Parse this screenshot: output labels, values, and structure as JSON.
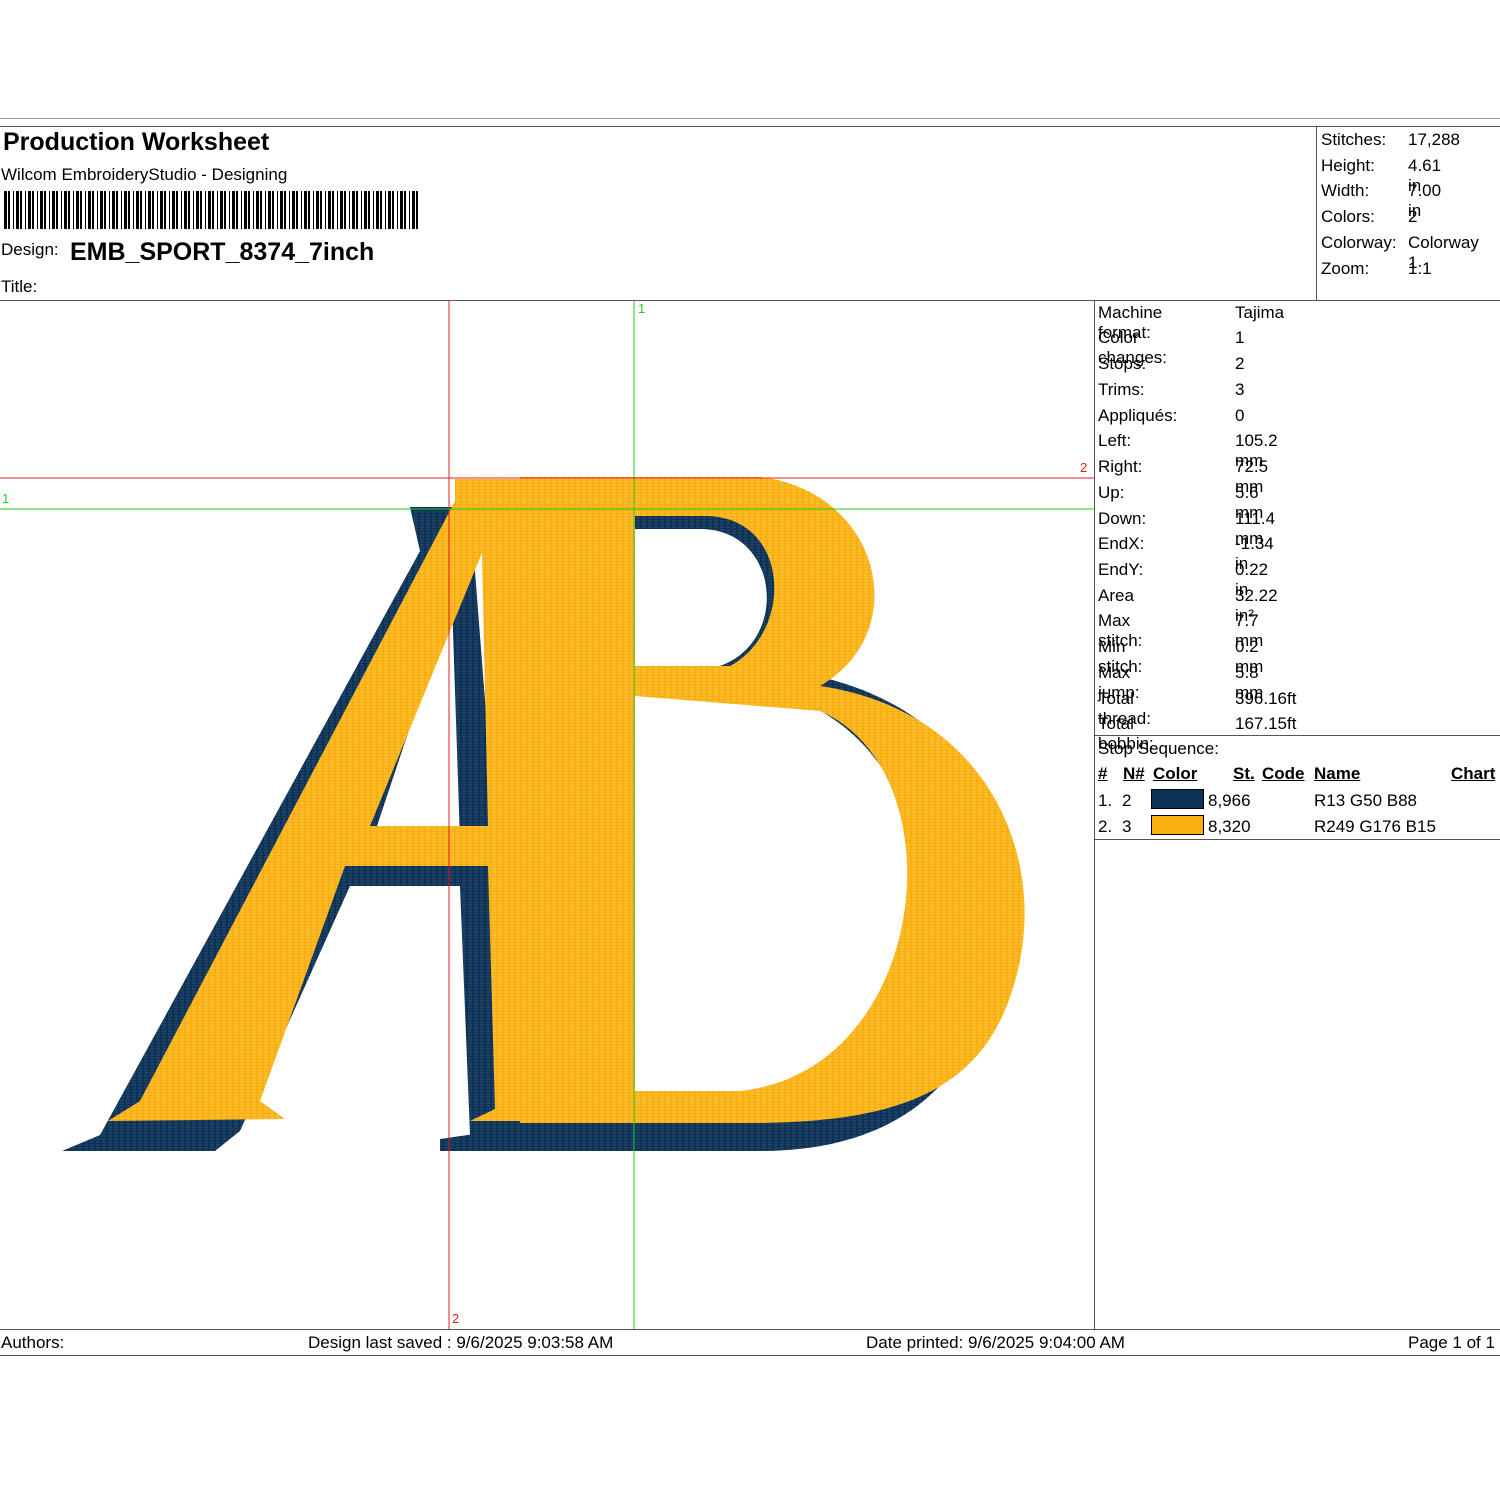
{
  "header": {
    "title": "Production Worksheet",
    "subtitle": "Wilcom EmbroideryStudio - Designing",
    "design_label": "Design:",
    "design_name": "EMB_SPORT_8374_7inch",
    "title_label": "Title:"
  },
  "summary": [
    {
      "label": "Stitches:",
      "value": "17,288"
    },
    {
      "label": "Height:",
      "value": "4.61 in"
    },
    {
      "label": "Width:",
      "value": "7.00 in"
    },
    {
      "label": "Colors:",
      "value": "2"
    },
    {
      "label": "Colorway:",
      "value": "Colorway 1"
    },
    {
      "label": "Zoom:",
      "value": "1:1"
    }
  ],
  "machine_info": [
    {
      "label": "Machine format:",
      "value": "Tajima"
    },
    {
      "label": "Color changes:",
      "value": "1"
    },
    {
      "label": "Stops:",
      "value": "2"
    },
    {
      "label": "Trims:",
      "value": "3"
    },
    {
      "label": "Appliqués:",
      "value": "0"
    },
    {
      "label": "Left:",
      "value": "105.2 mm"
    },
    {
      "label": "Right:",
      "value": "72.5 mm"
    },
    {
      "label": "Up:",
      "value": "5.6 mm"
    },
    {
      "label": "Down:",
      "value": "111.4 mm"
    },
    {
      "label": "EndX:",
      "value": "-1.34 in"
    },
    {
      "label": "EndY:",
      "value": "0.22 in"
    },
    {
      "label": "Area",
      "value": " 32.22 in²"
    },
    {
      "label": "Max stitch:",
      "value": "7.7 mm"
    },
    {
      "label": "Min stitch:",
      "value": "0.2 mm"
    },
    {
      "label": "Max jump:",
      "value": "5.8 mm"
    },
    {
      "label": "Total thread:",
      "value": "396.16ft"
    },
    {
      "label": "Total bobbin:",
      "value": "167.15ft"
    }
  ],
  "stop_sequence": {
    "label": "Stop Sequence:",
    "headers": {
      "num": "#",
      "needle": "N#",
      "color": "Color",
      "stitches": "St.",
      "code": "Code",
      "name": "Name",
      "chart": "Chart"
    },
    "rows": [
      {
        "num": "1.",
        "needle": "2",
        "color": "#0D3258",
        "stitches": "8,966",
        "name": "R13 G50 B88"
      },
      {
        "num": "2.",
        "needle": "3",
        "color": "#F9B00F",
        "stitches": "8,320",
        "name": "R249 G176 B15"
      }
    ]
  },
  "guides": {
    "v_red": "2",
    "v_green": "1",
    "h_red": "2",
    "h_green": "1"
  },
  "design_preview": {
    "letters": "AB",
    "shadow_color": "#0D3258",
    "fill_color": "#F9B00F"
  },
  "footer": {
    "authors": "Authors:",
    "saved": "Design last saved : 9/6/2025 9:03:58 AM",
    "printed": "Date printed: 9/6/2025 9:04:00 AM",
    "page": "Page 1 of 1"
  }
}
